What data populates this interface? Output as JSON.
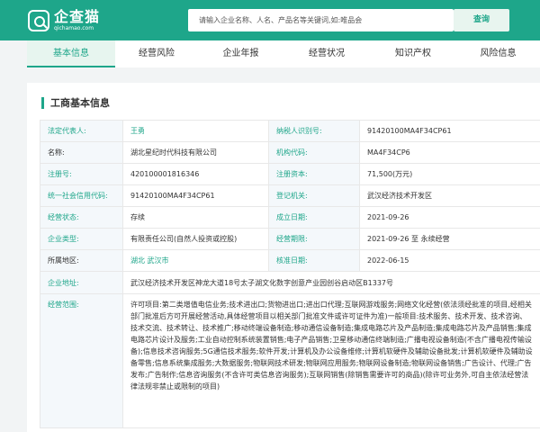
{
  "brand": {
    "name": "企查猫",
    "domain": "qichamao.com"
  },
  "search": {
    "placeholder": "请输入企业名称、人名、产品名等关键词,如:唯品会",
    "button": "查询"
  },
  "tabs": [
    "基本信息",
    "经营风险",
    "企业年报",
    "经营状况",
    "知识产权",
    "风险信息"
  ],
  "section_title": "工商基本信息",
  "rows": [
    {
      "l1": "法定代表人:",
      "v1": "王勇",
      "l2": "纳税人识别号:",
      "v2": "91420100MA4F34CP61"
    },
    {
      "l1": "名称:",
      "v1": "湖北星纪时代科技有限公司",
      "l2": "机构代码:",
      "v2": "MA4F34CP6"
    },
    {
      "l1": "注册号:",
      "v1": "420100001816346",
      "l2": "注册资本:",
      "v2": "71,500(万元)"
    },
    {
      "l1": "统一社会信用代码:",
      "v1": "91420100MA4F34CP61",
      "l2": "登记机关:",
      "v2": "武汉经济技术开发区"
    },
    {
      "l1": "经营状态:",
      "v1": "存续",
      "l2": "成立日期:",
      "v2": "2021-09-26"
    },
    {
      "l1": "企业类型:",
      "v1": "有限责任公司(自然人投资或控股)",
      "l2": "经营期限:",
      "v2": "2021-09-26 至 永续经营"
    },
    {
      "l1": "所属地区:",
      "v1": "湖北  武汉市",
      "l2": "核准日期:",
      "v2": "2022-06-15"
    }
  ],
  "address": {
    "label": "企业地址:",
    "value": "武汉经济技术开发区神龙大道18号太子湖文化数字创意产业园创谷启动区B1337号"
  },
  "scope": {
    "label": "经营范围:",
    "value": "许可项目:第二类增值电信业务;技术进出口;货物进出口;进出口代理;互联网游戏服务;网络文化经营(依法须经批准的项目,经相关部门批准后方可开展经营活动,具体经营项目以相关部门批准文件或许可证件为准)一般项目:技术服务、技术开发、技术咨询、技术交流、技术转让、技术推广;移动终端设备制造;移动通信设备制造;集成电路芯片及产品制造;集成电路芯片及产品销售;集成电路芯片设计及服务;工业自动控制系统装置销售;电子产品销售;卫星移动通信终端制造;广播电视设备制造(不含广播电视传输设备);信息技术咨询服务;5G通信技术服务;软件开发;计算机及办公设备维修;计算机软硬件及辅助设备批发;计算机软硬件及辅助设备零售;信息系统集成服务;大数据服务;物联网技术研发;物联网应用服务;物联网设备制造;物联网设备销售;广告设计、代理;广告发布;广告制作;信息咨询服务(不含许可类信息咨询服务);互联网销售(除销售需要许可的商品)(除许可业务外,可自主依法经营法律法规非禁止或限制的项目)"
  }
}
